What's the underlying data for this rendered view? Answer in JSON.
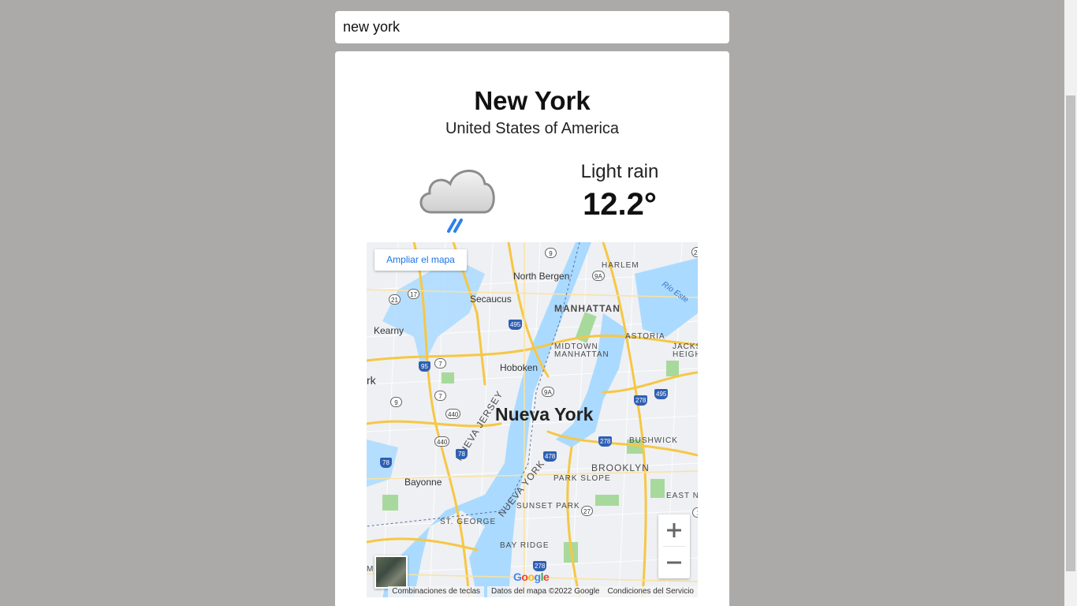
{
  "search": {
    "value": "new york"
  },
  "weather": {
    "city": "New York",
    "country": "United States of America",
    "condition": "Light rain",
    "temperature": "12.2°",
    "icon": "light-rain-cloud-icon"
  },
  "map": {
    "enlarge_label": "Ampliar el mapa",
    "zoom_in_icon": "plus-icon",
    "zoom_out_icon": "minus-icon",
    "logo": "Google",
    "footer": {
      "shortcuts": "Combinaciones de teclas",
      "data": "Datos del mapa ©2022 Google",
      "terms": "Condiciones del Servicio"
    },
    "labels": {
      "main": "Nueva York",
      "manhattan": "MANHATTAN",
      "harlem": "HARLEM",
      "midtown": "MIDTOWN\nMANHATTAN",
      "astoria": "ASTORIA",
      "brooklyn": "BROOKLYN",
      "bushwick": "BUSHWICK",
      "park_slope": "PARK SLOPE",
      "sunset_park": "SUNSET PARK",
      "bay_ridge": "BAY RIDGE",
      "st_george": "ST. GEORGE",
      "east_ny": "EAST NE",
      "jackson": "JACKSO\nHEIGH",
      "nueva_jersey": "NUEVA JERSEY",
      "nueva_york_rot": "NUEVA YORK",
      "north_bergen": "North Bergen",
      "secaucus": "Secaucus",
      "kearny": "Kearny",
      "hoboken": "Hoboken",
      "bayonne": "Bayonne",
      "rk": "rk",
      "mond": "MOND",
      "rio_este": "Río Este",
      "shields": [
        "9",
        "9A",
        "27",
        "495",
        "21",
        "17",
        "7",
        "95",
        "7",
        "9",
        "440",
        "440",
        "78",
        "9A",
        "278",
        "495",
        "278",
        "478",
        "78",
        "27",
        "278",
        "1",
        "78"
      ]
    }
  },
  "colors": {
    "page_bg": "#aca9a9",
    "card_bg": "#ffffff",
    "water": "#aadaff",
    "highway": "#f6c745",
    "park": "#a8d99c",
    "link": "#1a73e8"
  }
}
